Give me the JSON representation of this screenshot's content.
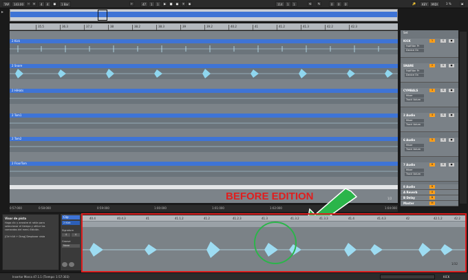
{
  "toolbar": {
    "tap": "TAP",
    "tempo": "143.00",
    "meter_num": "4",
    "meter_den": "4",
    "quant": "1 Bar",
    "pos": "47",
    "pos_beat": "1",
    "pos_sixteenth": "1",
    "loop_start": "114",
    "loop_len": "1",
    "loop_beat": "1",
    "key": "KEY",
    "midi": "MIDI",
    "cpu": "3 %"
  },
  "ruler": {
    "ticks": [
      "35.5",
      "36.3",
      "37.2",
      "38",
      "38.2",
      "38.3",
      "39",
      "39.2",
      "40.2",
      "41",
      "41.2",
      "41.3",
      "42.2",
      "42.3"
    ]
  },
  "tracks": [
    {
      "name": "2 Kick"
    },
    {
      "name": "2 Snare"
    },
    {
      "name": "2 HiHats"
    },
    {
      "name": "2 Tom1"
    },
    {
      "name": "2 Tom2"
    },
    {
      "name": "2 FloorTom"
    }
  ],
  "mixer": {
    "set": "Set",
    "tracks": [
      {
        "name": "KICK",
        "sub1": "FabFilter Pr",
        "sub2": "Device On"
      },
      {
        "name": "SNARE",
        "sub1": "FabFilter Pr",
        "sub2": "Device On"
      },
      {
        "name": "CYMBALS",
        "sub1": "Mixer",
        "sub2": "Track Volum"
      },
      {
        "name": "2 Audio",
        "sub1": "Mixer",
        "sub2": "Track Volum"
      },
      {
        "name": "6 Audio",
        "sub1": "Mixer",
        "sub2": "Track Volum"
      },
      {
        "name": "7 Audio",
        "sub1": "Mixer",
        "sub2": "Track Volum"
      }
    ],
    "returns": [
      "8 Audio",
      "A Reverb",
      "B Delay",
      "Master"
    ],
    "inf": "-inf",
    "count": "1/2"
  },
  "timeline": {
    "labels": [
      "0:57:000",
      "0:58:000",
      "0:59:000",
      "1:00:000",
      "1:01:000",
      "1:02:000",
      "1:03:000",
      "1:04:000"
    ]
  },
  "info": {
    "title": "Visor de pista",
    "body": "Haga clic y arrastre el ratón para seleccionar el tiempo y utilice los comandos del menú Edición.",
    "hint": "[Ctrl+Alt + Drag] Desplazar vista"
  },
  "clip": {
    "label": "Clip",
    "name": "2 Kick",
    "signature_label": "Signature",
    "sig_num": "4",
    "sig_den": "4",
    "groove_label": "Groove",
    "groove_value": "None",
    "ticks": [
      "40.4",
      "40.4.3",
      "41",
      "41.1.2",
      "41.2",
      "41.2.3",
      "41.3",
      "41.3.2",
      "41.3.3",
      "41.4",
      "41.4.3",
      "42",
      "42.1.2",
      "42.2"
    ],
    "ratio": "1/32"
  },
  "annotation": {
    "text": "BEFORE EDITION"
  },
  "status": {
    "text": "Insertar Marca 47.1.1 (Tiempo: 1:57:303)",
    "track": "KICK"
  }
}
